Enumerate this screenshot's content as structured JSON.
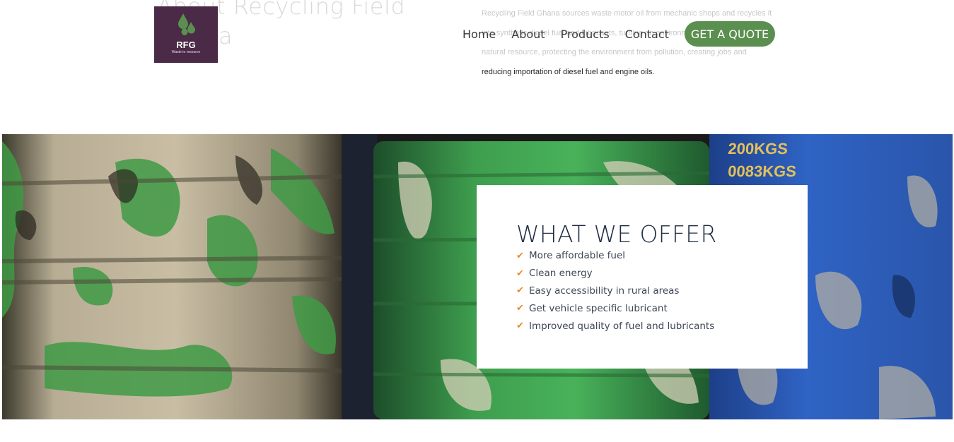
{
  "background_text": {
    "heading": "About Recycling Field Ghana",
    "paragraph_lines": [
      "Recycling Field Ghana sources waste motor oil from mechanic shops and recycles it",
      "into synthetic diesel fuel and lubricants, turning an environmental hazard into a",
      "natural resource, protecting the environment from pollution, creating jobs and"
    ],
    "paragraph_last_line": "reducing importation of diesel fuel and engine oils."
  },
  "header": {
    "logo": {
      "text": "RFG",
      "tagline": "Waste to resource",
      "icon": "oil-drops-icon",
      "bg_color": "#4a2a46",
      "accent_color": "#5b8f4f"
    },
    "nav": [
      {
        "label": "Home"
      },
      {
        "label": "About"
      },
      {
        "label": "Products"
      },
      {
        "label": "Contact"
      }
    ],
    "cta": {
      "label": "GET A QUOTE",
      "color": "#5b8f4f"
    }
  },
  "hero": {
    "image": "oil-drums-photo",
    "offer": {
      "title": "WHAT WE OFFER",
      "check_icon": "checkmark-icon",
      "check_color": "#e58a2e",
      "items": [
        "More affordable fuel",
        "Clean energy",
        "Easy accessibility in rural areas",
        "Get vehicle specific lubricant",
        "Improved quality of fuel and lubricants"
      ]
    }
  }
}
